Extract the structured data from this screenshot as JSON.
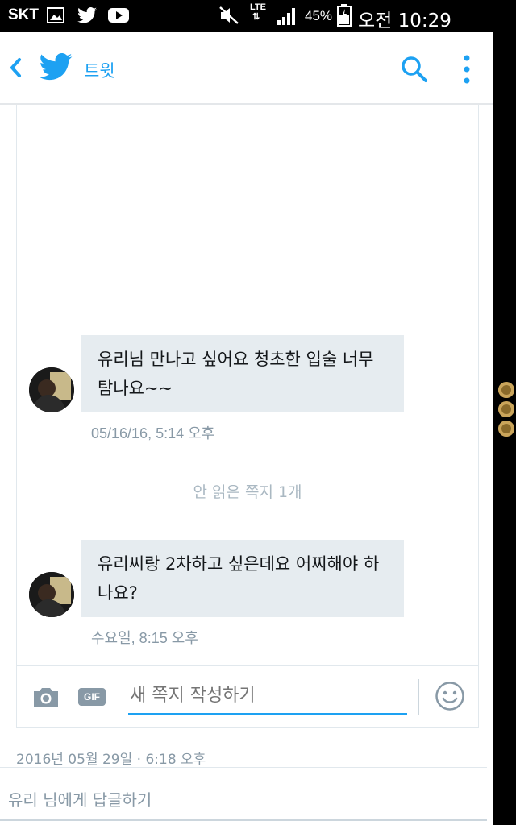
{
  "status_bar": {
    "carrier": "SKT",
    "network": "LTE",
    "battery": "45%",
    "time": "오전 10:29",
    "icons": [
      "gallery-icon",
      "twitter-icon",
      "youtube-icon",
      "mute-icon",
      "signal-icon",
      "battery-icon"
    ]
  },
  "header": {
    "title": "트윗"
  },
  "conversation": {
    "messages": [
      {
        "text": "유리님 만나고 싶어요 청초한 입술 너무 탐나요~~",
        "time": "05/16/16, 5:14 오후"
      },
      {
        "text": "유리씨랑 2차하고 싶은데요 어찌해야 하나요?",
        "time": "수요일, 8:15 오후"
      }
    ],
    "unread_divider": "안 읽은 쪽지 1개",
    "composer": {
      "gif_label": "GIF",
      "placeholder": "새 쪽지 작성하기"
    }
  },
  "tweet": {
    "timestamp": "2016년 05월 29일 · 6:18 오후",
    "reply_placeholder": "유리 님에게 답글하기"
  },
  "colors": {
    "accent": "#1da1f2",
    "bubble": "#e6ecf0",
    "muted": "#8899a6"
  }
}
